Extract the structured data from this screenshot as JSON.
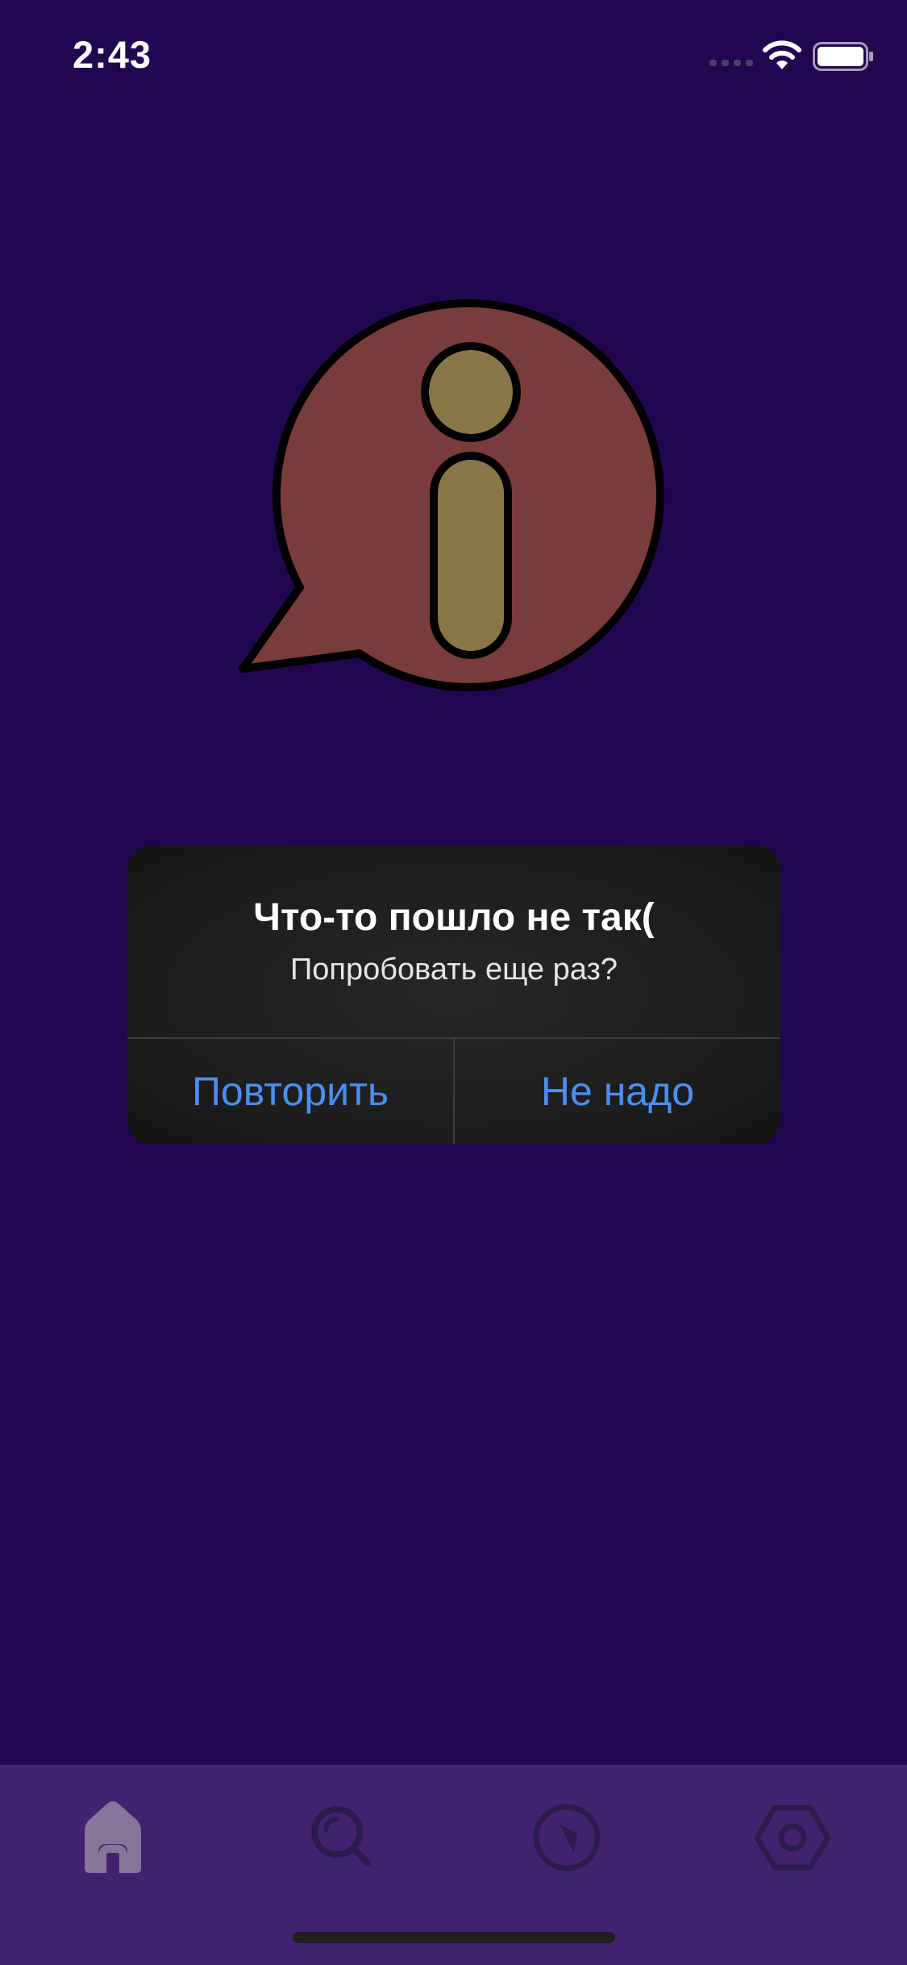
{
  "status_bar": {
    "time": "2:43",
    "icons": [
      "signal-icon",
      "wifi-icon",
      "battery-icon"
    ]
  },
  "illustration": {
    "icon": "info-speech-bubble-icon",
    "colors": {
      "bubble": "#7a3c3a",
      "glyph": "#877747",
      "outline": "#000000"
    }
  },
  "alert": {
    "title": "Что-то пошло не так(",
    "message": "Попробовать еще раз?",
    "buttons": [
      {
        "label": "Повторить"
      },
      {
        "label": "Не надо"
      }
    ]
  },
  "tab_bar": {
    "items": [
      {
        "icon": "home-icon",
        "active": true
      },
      {
        "icon": "search-icon",
        "active": false
      },
      {
        "icon": "compass-icon",
        "active": false
      },
      {
        "icon": "settings-hexagon-icon",
        "active": false
      }
    ]
  },
  "colors": {
    "background": "#21074f",
    "tab_bar": "#41246f",
    "accent": "#4a8ff2",
    "alert_background": "#1e1e1e"
  }
}
